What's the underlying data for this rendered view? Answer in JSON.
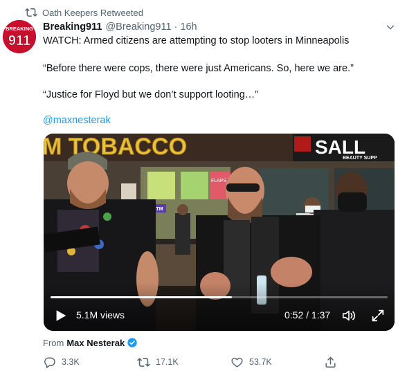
{
  "retweet_context": {
    "text": "Oath Keepers Retweeted",
    "icon": "retweet-icon"
  },
  "author": {
    "avatar_text": "BREAKING",
    "avatar_number": "911",
    "name": "Breaking911",
    "handle": "@Breaking911",
    "separator": "·",
    "time": "16h"
  },
  "tweet": {
    "line1": "WATCH: Armed citizens are attempting to stop looters in Minneapolis",
    "line2": "“Before there were cops, there were just Americans. So, here we are.”",
    "line3": "“Justice for Floyd but we don’t support looting…”",
    "mention": "@maxnesterak"
  },
  "video": {
    "views": "5.1M views",
    "timecode": "0:52 / 1:37",
    "progress": 0.537,
    "sign_left": "M TOBACCO",
    "sign_right": "SALL",
    "sign_right_sub": "BEAUTY SUPP",
    "sign_small": "FLAPS",
    "sign_small2": "ATM",
    "icons": {
      "play": "play-icon",
      "volume": "volume-icon",
      "fullscreen": "fullscreen-icon"
    }
  },
  "attribution": {
    "prefix": "From",
    "name": "Max Nesterak",
    "verified_icon": "verified-badge-icon"
  },
  "actions": {
    "reply_count": "3.3K",
    "retweet_count": "17.1K",
    "like_count": "53.7K"
  },
  "colors": {
    "accent": "#1d9bf0",
    "secondary_text": "#536471",
    "avatar_red": "#c8102e"
  }
}
